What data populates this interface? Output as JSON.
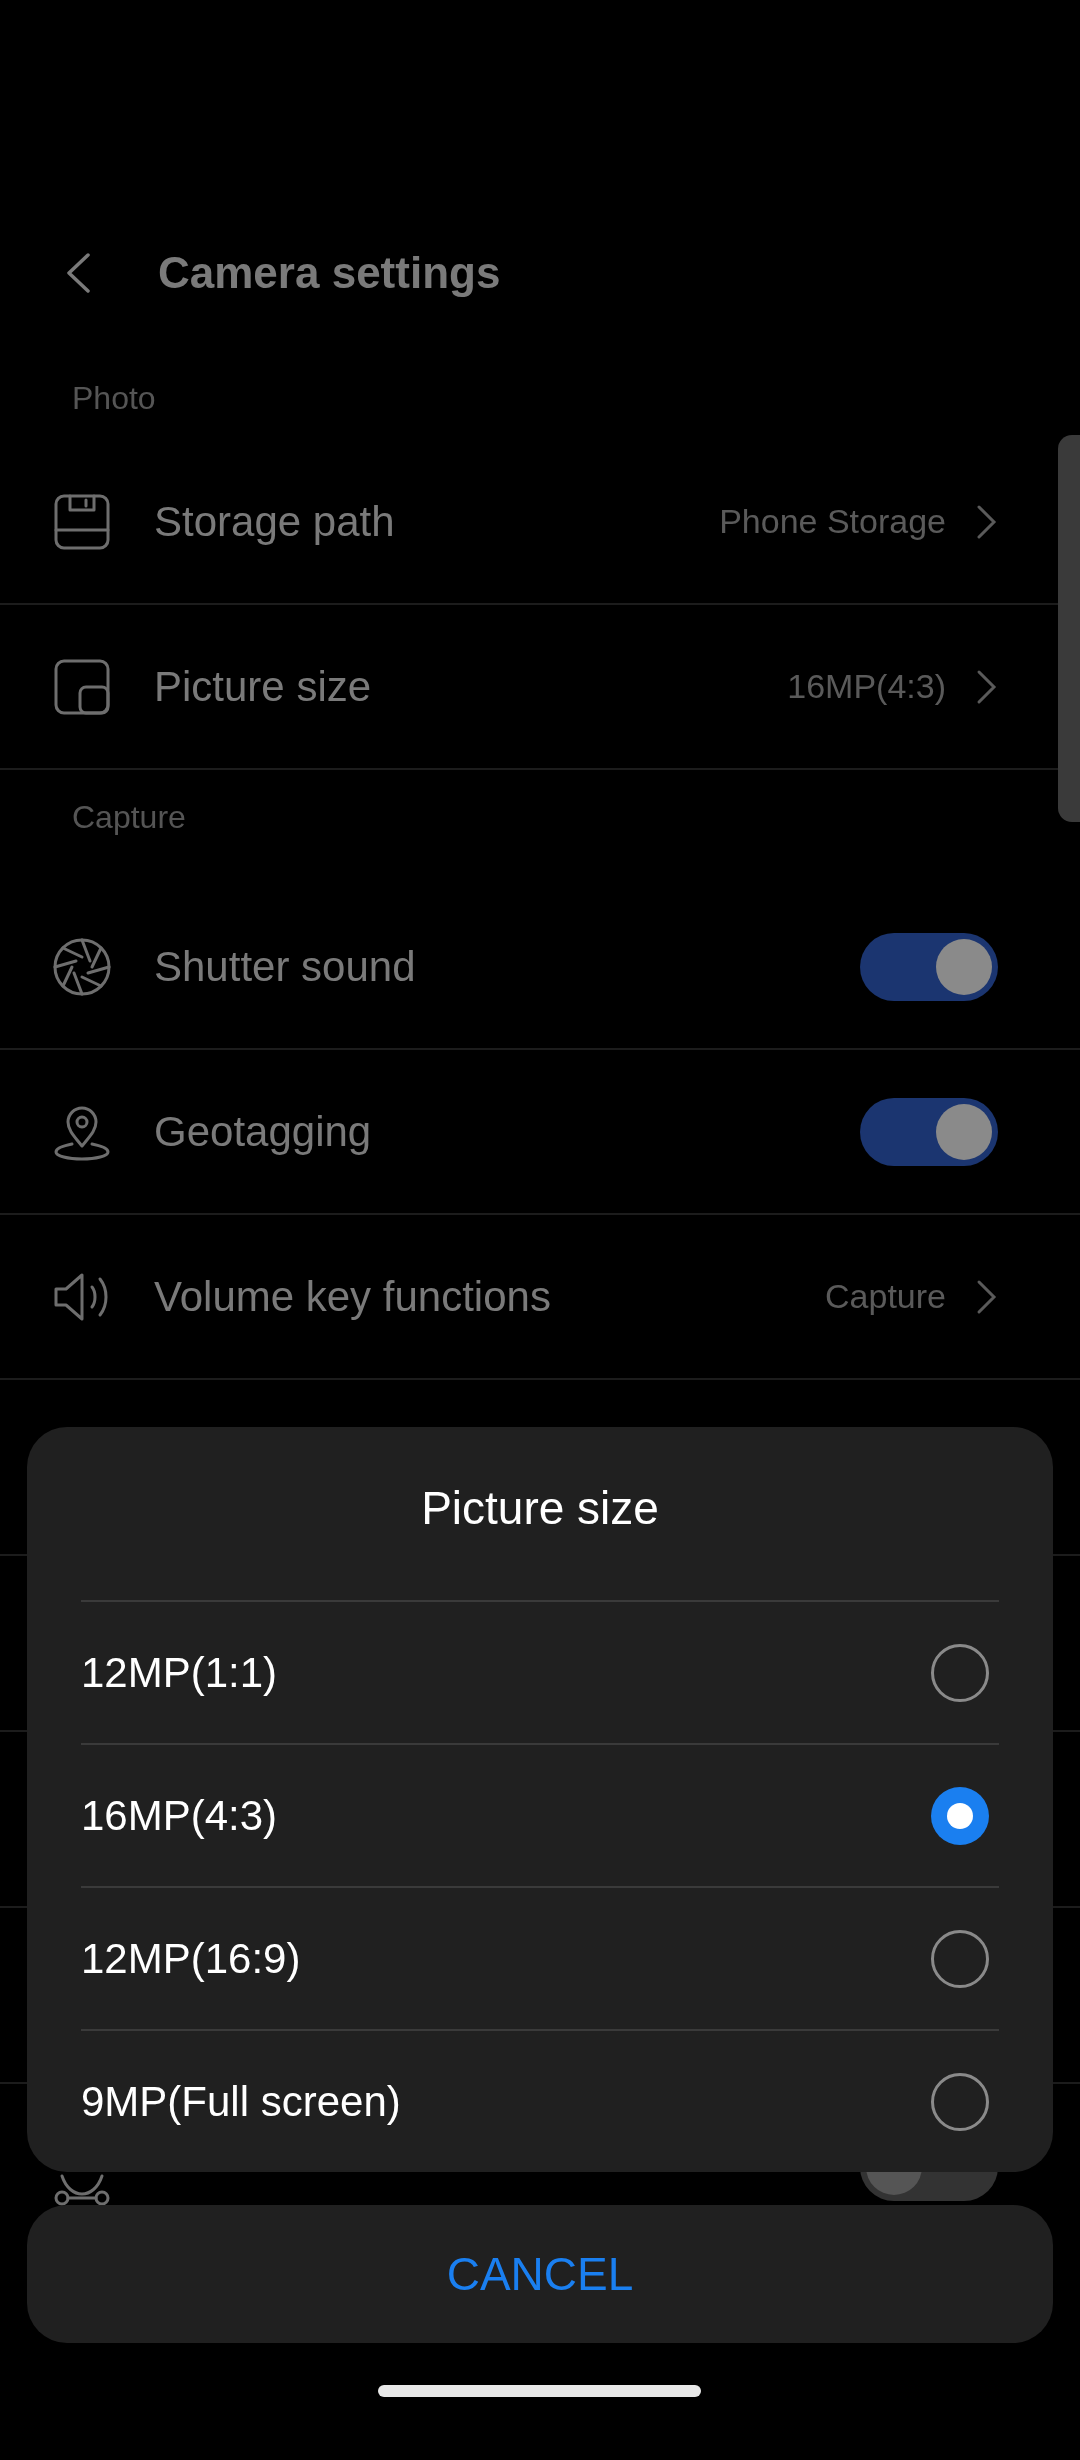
{
  "header": {
    "title": "Camera settings"
  },
  "sections": [
    {
      "title": "Photo",
      "items": [
        {
          "kind": "link",
          "label": "Storage path",
          "value": "Phone Storage"
        },
        {
          "kind": "link",
          "label": "Picture size",
          "value": "16MP(4:3)"
        }
      ]
    },
    {
      "title": "Capture",
      "items": [
        {
          "kind": "toggle",
          "label": "Shutter sound",
          "on": true
        },
        {
          "kind": "toggle",
          "label": "Geotagging",
          "on": true
        },
        {
          "kind": "link",
          "label": "Volume key functions",
          "value": "Capture"
        }
      ]
    }
  ],
  "hidden_row": {
    "on": false
  },
  "dialog": {
    "title": "Picture size",
    "options": [
      {
        "label": "12MP(1:1)",
        "selected": false
      },
      {
        "label": "16MP(4:3)",
        "selected": true
      },
      {
        "label": "12MP(16:9)",
        "selected": false
      },
      {
        "label": "9MP(Full screen)",
        "selected": false
      }
    ],
    "cancel": "CANCEL"
  }
}
